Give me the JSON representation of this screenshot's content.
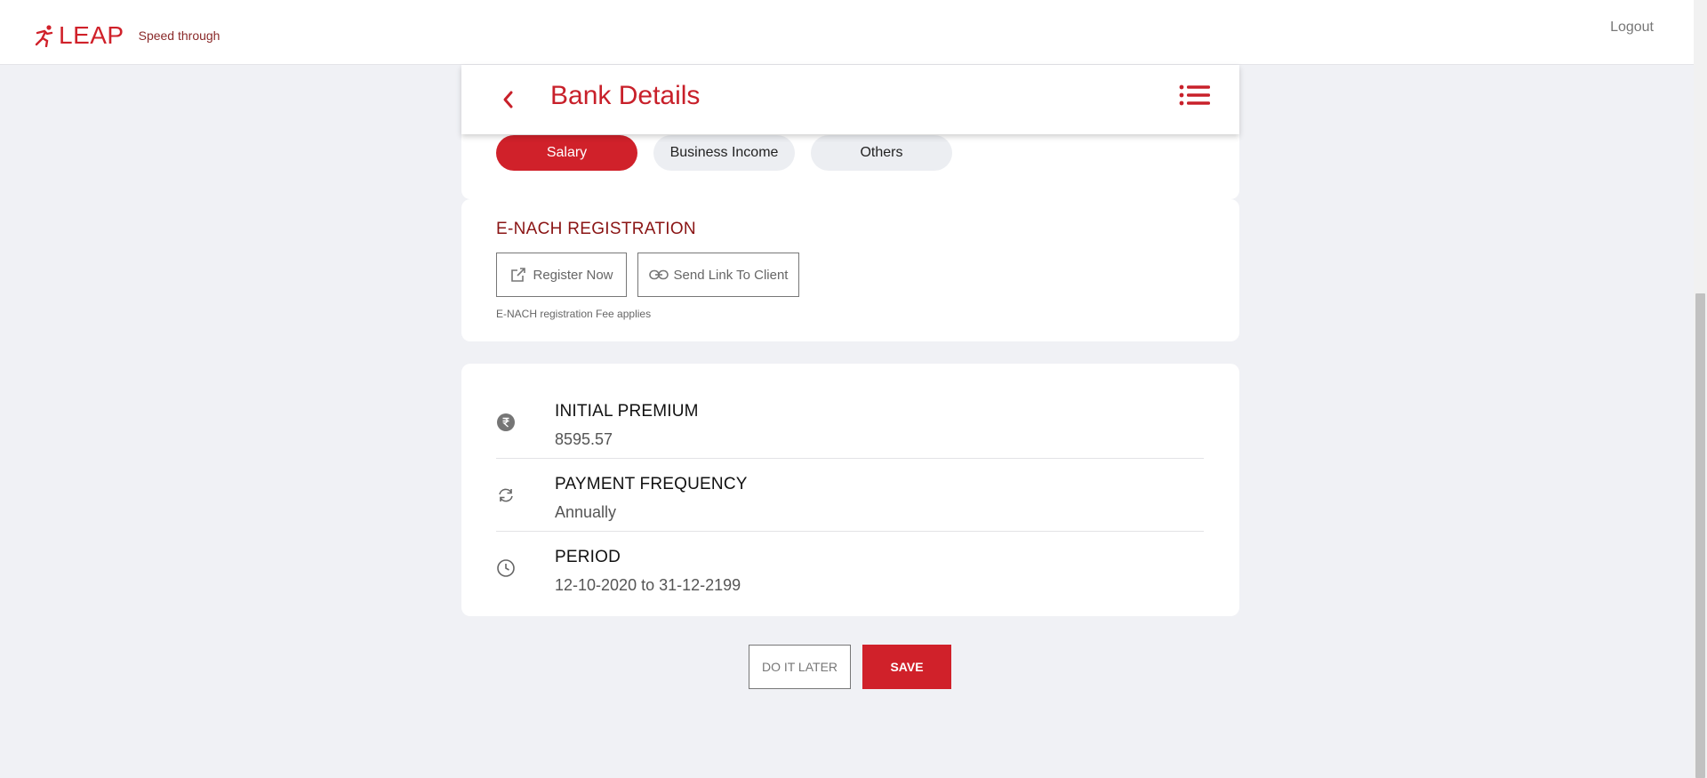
{
  "header": {
    "brand_name": "LEAP",
    "tagline": "Speed through",
    "logout_label": "Logout"
  },
  "page": {
    "title": "Bank Details",
    "back_icon": "chevron-left-icon",
    "menu_icon": "list-icon"
  },
  "income_tabs": [
    {
      "label": "Salary",
      "active": true
    },
    {
      "label": "Business Income",
      "active": false
    },
    {
      "label": "Others",
      "active": false
    }
  ],
  "enach": {
    "title": "E-NACH REGISTRATION",
    "register_label": "Register Now",
    "send_link_label": "Send Link To Client",
    "note": "E-NACH registration Fee applies"
  },
  "summary": [
    {
      "icon": "rupee-icon",
      "label": "INITIAL PREMIUM",
      "value": "8595.57"
    },
    {
      "icon": "refresh-icon",
      "label": "PAYMENT FREQUENCY",
      "value": "Annually"
    },
    {
      "icon": "clock-icon",
      "label": "PERIOD",
      "value": "12-10-2020 to 31-12-2199"
    }
  ],
  "actions": {
    "later_label": "DO IT LATER",
    "save_label": "SAVE"
  },
  "colors": {
    "accent": "#d0212a",
    "background": "#f0f1f5"
  }
}
